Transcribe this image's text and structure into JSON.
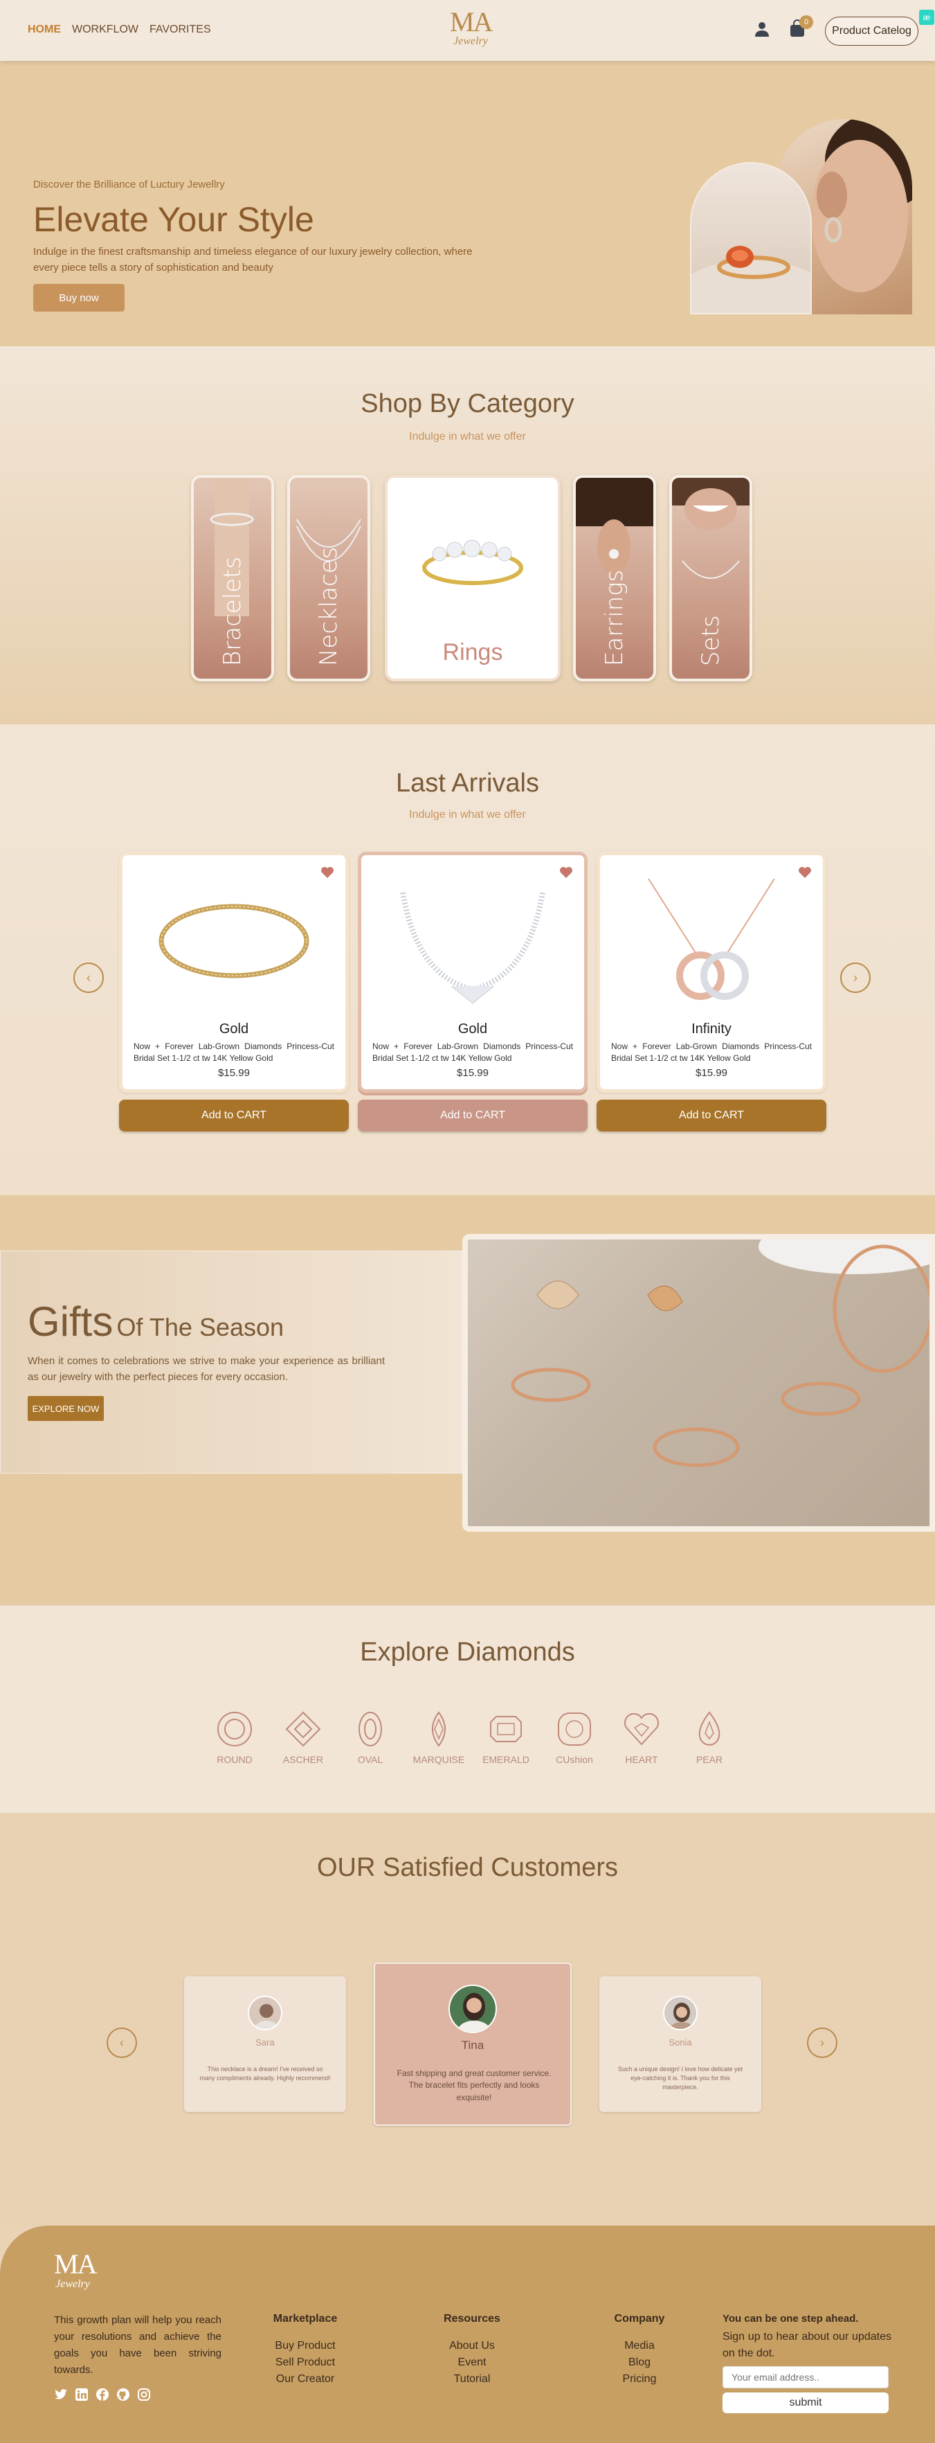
{
  "nav": {
    "links": [
      "HOME",
      "WORKFLOW",
      "FAVORITES"
    ],
    "logo_main": "MA",
    "logo_sub": "Jewelry",
    "cart_count": "0",
    "catalog_button": "Product Catelog",
    "badge_ext": "æ"
  },
  "hero": {
    "kicker": "Discover the Brilliance of Luctury Jewellry",
    "title": "Elevate Your Style",
    "description": "Indulge in the finest craftsmanship and timeless elegance of our luxury jewelry collection, where every piece tells a story of sophistication and beauty",
    "button": "Buy now"
  },
  "category": {
    "title": "Shop By Category",
    "subtitle": "Indulge in what we offer",
    "items": [
      "Bracelets",
      "Necklaces",
      "Rings",
      "Earrings",
      "Sets"
    ]
  },
  "arrivals": {
    "title": "Last Arrivals",
    "subtitle": "Indulge in what we offer",
    "products": [
      {
        "name": "Gold",
        "desc": "Now + Forever Lab-Grown Diamonds Princess-Cut Bridal Set 1-1/2 ct tw 14K Yellow Gold",
        "price": "$15.99",
        "button": "Add to CART"
      },
      {
        "name": "Gold",
        "desc": "Now + Forever Lab-Grown Diamonds Princess-Cut Bridal Set 1-1/2 ct tw 14K Yellow Gold",
        "price": "$15.99",
        "button": "Add to CART"
      },
      {
        "name": "Infinity",
        "desc": "Now + Forever Lab-Grown Diamonds Princess-Cut Bridal Set 1-1/2 ct tw 14K Yellow Gold",
        "price": "$15.99",
        "button": "Add to CART"
      }
    ],
    "prev": "‹",
    "next": "›"
  },
  "gifts": {
    "title_big": "Gifts",
    "title_small": "Of The Season",
    "description": "When it comes to celebrations we strive to make your experience as brilliant as our jewelry with the perfect pieces for every occasion.",
    "button": "EXPLORE NOW"
  },
  "diamonds": {
    "title": "Explore Diamonds",
    "shapes": [
      "ROUND",
      "ASCHER",
      "OVAL",
      "MARQUISE",
      "EMERALD",
      "CUshion",
      "HEART",
      "PEAR"
    ]
  },
  "customers": {
    "title": "OUR Satisfied Customers",
    "items": [
      {
        "name": "Sara",
        "quote": "This necklace is a dream! I've received so many compliments already. Highly recommend!"
      },
      {
        "name": "Tina",
        "quote": "Fast shipping and great customer service. The bracelet fits perfectly and looks exquisite!"
      },
      {
        "name": "Sonia",
        "quote": "Such a unique design! I love how delicate yet eye-catching it is. Thank you for this masterpiece."
      }
    ],
    "prev": "‹",
    "next": "›"
  },
  "footer": {
    "logo_main": "MA",
    "logo_sub": "Jewelry",
    "about": "This growth plan will help you reach your resolutions and achieve the goals you have been striving towards.",
    "columns": [
      {
        "title": "Marketplace",
        "items": [
          "Buy Product",
          "Sell Product",
          "Our Creator"
        ]
      },
      {
        "title": "Resources",
        "items": [
          "About Us",
          "Event",
          "Tutorial"
        ]
      },
      {
        "title": "Company",
        "items": [
          "Media",
          "Blog",
          "Pricing"
        ]
      }
    ],
    "news_title": "You can be one step ahead.",
    "news_text": "Sign up to hear about our updates on the dot.",
    "email_placeholder": "Your email address..",
    "submit": "submit"
  },
  "colors": {
    "accent": "#a87429",
    "sand": "#e6caa2",
    "rose": "#c89586",
    "footer": "#c79f63"
  }
}
